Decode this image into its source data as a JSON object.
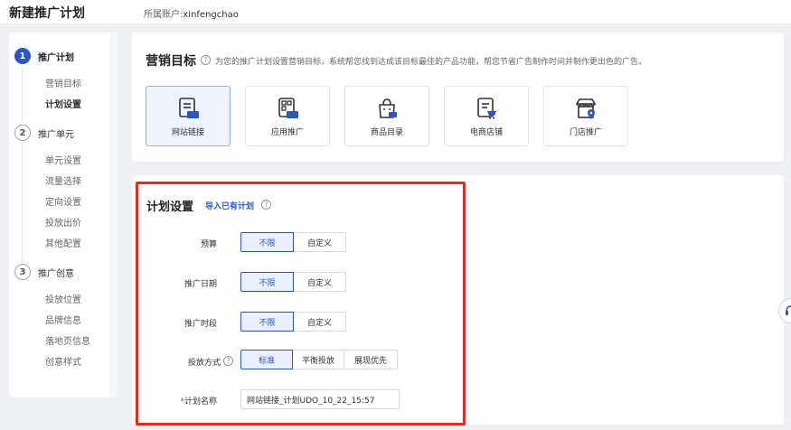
{
  "header": {
    "title": "新建推广计划",
    "account_label": "所属账户:",
    "account_value": "xinfengchao"
  },
  "sidebar": {
    "steps": [
      {
        "num": "1",
        "label": "推广计划",
        "active": true,
        "items": [
          "营销目标",
          "计划设置"
        ]
      },
      {
        "num": "2",
        "label": "推广单元",
        "active": false,
        "items": [
          "单元设置",
          "流量选择",
          "定向设置",
          "投放出价",
          "其他配置"
        ]
      },
      {
        "num": "3",
        "label": "推广创意",
        "active": false,
        "items": [
          "投放位置",
          "品牌信息",
          "落地页信息",
          "创意样式"
        ]
      }
    ]
  },
  "goal_section": {
    "title": "营销目标",
    "description": "为您的推广计划设置营销目标，系统帮您找到达成该目标最佳的产品功能，帮您节省广告制作时间并制作更出色的广告。",
    "options": [
      {
        "label": "网站链接",
        "icon": "website-icon",
        "selected": true
      },
      {
        "label": "应用推广",
        "icon": "app-icon",
        "selected": false
      },
      {
        "label": "商品目录",
        "icon": "shopping-bag-icon",
        "selected": false
      },
      {
        "label": "电商店铺",
        "icon": "ecommerce-store-icon",
        "selected": false
      },
      {
        "label": "门店推广",
        "icon": "storefront-icon",
        "selected": false
      }
    ]
  },
  "plan_settings": {
    "title": "计划设置",
    "import_link": "导入已有计划",
    "rows": [
      {
        "label": "预算",
        "options": [
          "不限",
          "自定义"
        ],
        "selected": "不限"
      },
      {
        "label": "推广日期",
        "options": [
          "不限",
          "自定义"
        ],
        "selected": "不限"
      },
      {
        "label": "推广时段",
        "options": [
          "不限",
          "自定义"
        ],
        "selected": "不限"
      },
      {
        "label": "投放方式",
        "options": [
          "标准",
          "平衡投放",
          "展现优先"
        ],
        "selected": "标准"
      }
    ],
    "plan_name": {
      "required_mark": "*",
      "label": "计划名称",
      "value": "网站链接_计划UDO_10_22_15:57"
    }
  },
  "colors": {
    "accent": "#2c55c8",
    "highlight_border": "#e8291c",
    "background": "#eef0f4"
  }
}
